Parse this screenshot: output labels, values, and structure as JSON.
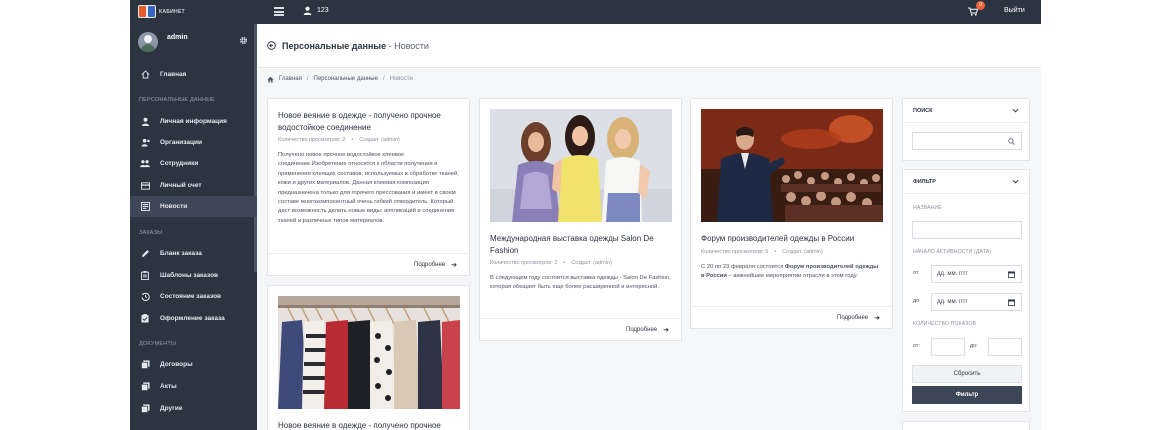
{
  "topbar": {
    "logo_text": "КАБИНЕТ",
    "user_count": "123",
    "cart_badge": "0",
    "logout_label": "Выйти"
  },
  "sidebar": {
    "profile_name": "admin",
    "items_main": [
      {
        "label": "Главная",
        "icon": "home-icon"
      }
    ],
    "section_personal": "ПЕРСОНАЛЬНЫЕ ДАННЫЕ",
    "items_personal": [
      {
        "label": "Личная информация",
        "icon": "user-icon"
      },
      {
        "label": "Организации",
        "icon": "organization-icon"
      },
      {
        "label": "Сотрудники",
        "icon": "employees-icon"
      },
      {
        "label": "Личный счет",
        "icon": "card-icon"
      },
      {
        "label": "Новости",
        "icon": "news-icon",
        "active": true
      }
    ],
    "section_orders": "ЗАКАЗЫ",
    "items_orders": [
      {
        "label": "Бланк заказа",
        "icon": "pencil-icon"
      },
      {
        "label": "Шаблоны заказов",
        "icon": "clipboard-icon"
      },
      {
        "label": "Состояние заказов",
        "icon": "history-icon"
      },
      {
        "label": "Оформление заказа",
        "icon": "clipboard-check-icon"
      }
    ],
    "section_documents": "ДОКУМЕНТЫ",
    "items_documents": [
      {
        "label": "Договоры",
        "icon": "documents-icon"
      },
      {
        "label": "Акты",
        "icon": "documents-icon"
      },
      {
        "label": "Другие",
        "icon": "documents-icon"
      }
    ]
  },
  "page": {
    "title_bold": "Персональные данные",
    "title_rest": " - Новости"
  },
  "breadcrumb": [
    "Главная",
    "Персональные данные",
    "Новости"
  ],
  "news": [
    {
      "title": "Новое веяние в одежде - получено прочное водостойкое соединение",
      "views": "Количество просмотров: 2",
      "author": "Создал: (admin)",
      "text": "Получено новое прочное водостойкое клеевое соединение.Изобретение относится к области получения и применения клеящих составов, используемых в обработке тканей, кожи и других материалов. Данная клеевая композиция предназначена только для горячего прессования и имеет в своем составе многокомпонентный очень гибкий отвердитель. Который даст возможность делать новые виды: аппликаций и соединения тканей и различных типов материалов.",
      "more": "Подробнее"
    },
    {
      "title": "Международная выставка одежды Salon De Fashion",
      "views": "Количество просмотров: 2",
      "author": "Создал: (admin)",
      "text": "В следующем году состоится выставка одежды - Salon De Fashion, которая обещает быть еще более расширенной и интересной.",
      "more": "Подробнее"
    },
    {
      "title": "Форум производителей одежды в России",
      "views": "Количество просмотров: 5",
      "author": "Создал: (admin)",
      "text_pre": "С 20 по 23 февраля состоится ",
      "text_bold": "Форум производителей одежды в России",
      "text_post": " – важнейшее мероприятии отрасли в этом году.",
      "more": "Подробнее"
    },
    {
      "title": "Новое веяние в одежде - получено прочное"
    }
  ],
  "search_panel": {
    "title": "ПОИСК"
  },
  "filter_panel": {
    "title": "ФИЛЬТР",
    "name_label": "НАЗВАНИЕ",
    "activity_label": "НАЧАЛО АКТИВНОСТИ (ДАТА)",
    "from_label": "от",
    "to_label": "до",
    "date_placeholder": "дд. мм. гггг",
    "shows_label": "КОЛИЧЕСТВО ПОКАЗОВ",
    "shows_from": "от:",
    "shows_to": "до:",
    "reset_label": "Сбросить",
    "filter_label": "Фильтр"
  }
}
